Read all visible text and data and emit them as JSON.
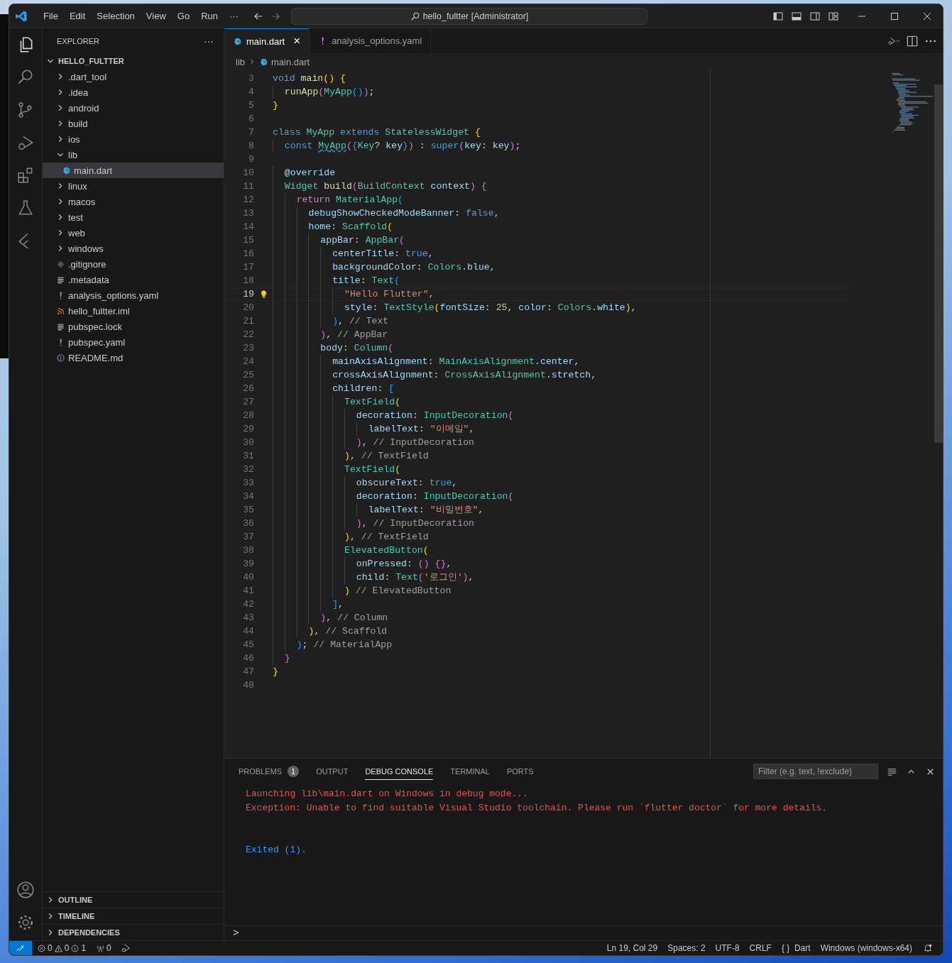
{
  "window": {
    "title": "hello_fultter [Administrator]",
    "menu": [
      "File",
      "Edit",
      "Selection",
      "View",
      "Go",
      "Run"
    ],
    "more": "···"
  },
  "sidebar": {
    "title": "EXPLORER",
    "more": "···",
    "root": {
      "label": "HELLO_FULTTER",
      "expanded": true
    },
    "tree": [
      {
        "label": ".dart_tool",
        "kind": "folder",
        "expanded": false,
        "selected": false
      },
      {
        "label": ".idea",
        "kind": "folder",
        "expanded": false,
        "selected": false
      },
      {
        "label": "android",
        "kind": "folder",
        "expanded": false,
        "selected": false
      },
      {
        "label": "build",
        "kind": "folder",
        "expanded": false,
        "selected": false
      },
      {
        "label": "ios",
        "kind": "folder",
        "expanded": false,
        "selected": false
      },
      {
        "label": "lib",
        "kind": "folder",
        "expanded": true,
        "selected": false,
        "children": [
          {
            "label": "main.dart",
            "kind": "dart",
            "selected": true
          }
        ]
      },
      {
        "label": "linux",
        "kind": "folder",
        "expanded": false,
        "selected": false
      },
      {
        "label": "macos",
        "kind": "folder",
        "expanded": false,
        "selected": false
      },
      {
        "label": "test",
        "kind": "folder",
        "expanded": false,
        "selected": false
      },
      {
        "label": "web",
        "kind": "folder",
        "expanded": false,
        "selected": false
      },
      {
        "label": "windows",
        "kind": "folder",
        "expanded": false,
        "selected": false
      },
      {
        "label": ".gitignore",
        "kind": "git",
        "selected": false
      },
      {
        "label": ".metadata",
        "kind": "lines",
        "selected": false
      },
      {
        "label": "analysis_options.yaml",
        "kind": "yaml",
        "selected": false
      },
      {
        "label": "hello_fultter.iml",
        "kind": "feed",
        "selected": false
      },
      {
        "label": "pubspec.lock",
        "kind": "lines",
        "selected": false
      },
      {
        "label": "pubspec.yaml",
        "kind": "yaml",
        "selected": false
      },
      {
        "label": "README.md",
        "kind": "info",
        "selected": false
      }
    ],
    "sections": [
      {
        "label": "OUTLINE",
        "expanded": false
      },
      {
        "label": "TIMELINE",
        "expanded": false
      },
      {
        "label": "DEPENDENCIES",
        "expanded": false
      }
    ]
  },
  "editor": {
    "tabs": [
      {
        "label": "main.dart",
        "kind": "dart",
        "selected": true,
        "close": "×"
      },
      {
        "label": "analysis_options.yaml",
        "kind": "yaml",
        "selected": false
      }
    ],
    "breadcrumb": [
      "lib",
      "main.dart"
    ],
    "lines": [
      {
        "n": "3",
        "current": false,
        "tokens": [
          {
            "kind": "kw",
            "text": "void"
          },
          {
            "kind": "fn",
            "text": " main"
          },
          {
            "kind": "b1",
            "text": "()"
          },
          {
            "kind": "b1",
            "text": " {"
          }
        ]
      },
      {
        "n": "4",
        "current": false,
        "tokens": [
          {
            "kind": "fn",
            "text": "  runApp"
          },
          {
            "kind": "b2",
            "text": "("
          },
          {
            "kind": "type",
            "text": "MyApp"
          },
          {
            "kind": "b3",
            "text": "()"
          },
          {
            "kind": "b2",
            "text": ")"
          },
          {
            "kind": "p",
            "text": ";"
          }
        ]
      },
      {
        "n": "5",
        "current": false,
        "tokens": [
          {
            "kind": "b1",
            "text": "}"
          }
        ]
      },
      {
        "n": "6",
        "current": false
      },
      {
        "n": "7",
        "current": false,
        "tokens": [
          {
            "kind": "kw",
            "text": "class"
          },
          {
            "kind": "type",
            "text": " MyApp"
          },
          {
            "kind": "kw",
            "text": " extends"
          },
          {
            "kind": "type",
            "text": " StatelessWidget"
          },
          {
            "kind": "b1",
            "text": " {"
          }
        ]
      },
      {
        "n": "8",
        "current": false,
        "tokens": [
          {
            "kind": "kw",
            "text": "  const "
          },
          {
            "kind": "warn",
            "text": "MyApp"
          },
          {
            "kind": "b2",
            "text": "("
          },
          {
            "kind": "b3",
            "text": "{"
          },
          {
            "kind": "type",
            "text": "Key"
          },
          {
            "kind": "p",
            "text": "? "
          },
          {
            "kind": "var",
            "text": "key"
          },
          {
            "kind": "b3",
            "text": "}"
          },
          {
            "kind": "b2",
            "text": ")"
          },
          {
            "kind": "p",
            "text": " : "
          },
          {
            "kind": "kw",
            "text": "super"
          },
          {
            "kind": "b2",
            "text": "("
          },
          {
            "kind": "var",
            "text": "key"
          },
          {
            "kind": "p",
            "text": ": "
          },
          {
            "kind": "var",
            "text": "key"
          },
          {
            "kind": "b2",
            "text": ")"
          },
          {
            "kind": "p",
            "text": ";"
          }
        ]
      },
      {
        "n": "9",
        "current": false
      },
      {
        "n": "10",
        "current": false,
        "tokens": [
          {
            "kind": "var",
            "text": "  @override"
          }
        ]
      },
      {
        "n": "11",
        "current": false,
        "tokens": [
          {
            "kind": "type",
            "text": "  Widget"
          },
          {
            "kind": "fn",
            "text": " build"
          },
          {
            "kind": "b2",
            "text": "("
          },
          {
            "kind": "type",
            "text": "BuildContext"
          },
          {
            "kind": "var",
            "text": " context"
          },
          {
            "kind": "b2",
            "text": ")"
          },
          {
            "kind": "b2",
            "text": " {"
          }
        ]
      },
      {
        "n": "12",
        "current": false,
        "tokens": [
          {
            "kind": "ctrl",
            "text": "    return"
          },
          {
            "kind": "type",
            "text": " MaterialApp"
          },
          {
            "kind": "b3",
            "text": "("
          }
        ]
      },
      {
        "n": "13",
        "current": false,
        "tokens": [
          {
            "kind": "var",
            "text": "      debugShowCheckedModeBanner"
          },
          {
            "kind": "p",
            "text": ": "
          },
          {
            "kind": "kw",
            "text": "false"
          },
          {
            "kind": "p",
            "text": ","
          }
        ]
      },
      {
        "n": "14",
        "current": false,
        "tokens": [
          {
            "kind": "var",
            "text": "      home"
          },
          {
            "kind": "p",
            "text": ": "
          },
          {
            "kind": "type",
            "text": "Scaffold"
          },
          {
            "kind": "b1",
            "text": "("
          }
        ]
      },
      {
        "n": "15",
        "current": false,
        "tokens": [
          {
            "kind": "var",
            "text": "        appBar"
          },
          {
            "kind": "p",
            "text": ": "
          },
          {
            "kind": "type",
            "text": "AppBar"
          },
          {
            "kind": "b2",
            "text": "("
          }
        ]
      },
      {
        "n": "16",
        "current": false,
        "tokens": [
          {
            "kind": "var",
            "text": "          centerTitle"
          },
          {
            "kind": "p",
            "text": ": "
          },
          {
            "kind": "kw",
            "text": "true"
          },
          {
            "kind": "p",
            "text": ","
          }
        ]
      },
      {
        "n": "17",
        "current": false,
        "tokens": [
          {
            "kind": "var",
            "text": "          backgroundColor"
          },
          {
            "kind": "p",
            "text": ": "
          },
          {
            "kind": "type",
            "text": "Colors"
          },
          {
            "kind": "p",
            "text": "."
          },
          {
            "kind": "var",
            "text": "blue"
          },
          {
            "kind": "p",
            "text": ","
          }
        ]
      },
      {
        "n": "18",
        "current": false,
        "tokens": [
          {
            "kind": "var",
            "text": "          title"
          },
          {
            "kind": "p",
            "text": ": "
          },
          {
            "kind": "type",
            "text": "Text"
          },
          {
            "kind": "b3",
            "text": "("
          }
        ]
      },
      {
        "n": "19",
        "current": true,
        "tokens": [
          {
            "kind": "str",
            "text": "            \"Hello Flutter\""
          },
          {
            "kind": "p",
            "text": ","
          }
        ]
      },
      {
        "n": "20",
        "current": false,
        "tokens": [
          {
            "kind": "var",
            "text": "            style"
          },
          {
            "kind": "p",
            "text": ": "
          },
          {
            "kind": "type",
            "text": "TextStyle"
          },
          {
            "kind": "b1",
            "text": "("
          },
          {
            "kind": "var",
            "text": "fontSize"
          },
          {
            "kind": "p",
            "text": ": "
          },
          {
            "kind": "num",
            "text": "25"
          },
          {
            "kind": "p",
            "text": ", "
          },
          {
            "kind": "var",
            "text": "color"
          },
          {
            "kind": "p",
            "text": ": "
          },
          {
            "kind": "type",
            "text": "Colors"
          },
          {
            "kind": "p",
            "text": "."
          },
          {
            "kind": "var",
            "text": "white"
          },
          {
            "kind": "b1",
            "text": ")"
          },
          {
            "kind": "p",
            "text": ","
          }
        ]
      },
      {
        "n": "21",
        "current": false,
        "tokens": [
          {
            "kind": "b3",
            "text": "          )"
          },
          {
            "kind": "p",
            "text": ", "
          },
          {
            "kind": "cmt",
            "text": "// Text"
          }
        ]
      },
      {
        "n": "22",
        "current": false,
        "tokens": [
          {
            "kind": "b2",
            "text": "        )"
          },
          {
            "kind": "p",
            "text": ", "
          },
          {
            "kind": "cmt",
            "text": "// AppBar"
          }
        ]
      },
      {
        "n": "23",
        "current": false,
        "tokens": [
          {
            "kind": "var",
            "text": "        body"
          },
          {
            "kind": "p",
            "text": ": "
          },
          {
            "kind": "type",
            "text": "Column"
          },
          {
            "kind": "b2",
            "text": "("
          }
        ]
      },
      {
        "n": "24",
        "current": false,
        "tokens": [
          {
            "kind": "var",
            "text": "          mainAxisAlignment"
          },
          {
            "kind": "p",
            "text": ": "
          },
          {
            "kind": "type",
            "text": "MainAxisAlignment"
          },
          {
            "kind": "p",
            "text": "."
          },
          {
            "kind": "var",
            "text": "center"
          },
          {
            "kind": "p",
            "text": ","
          }
        ]
      },
      {
        "n": "25",
        "current": false,
        "tokens": [
          {
            "kind": "var",
            "text": "          crossAxisAlignment"
          },
          {
            "kind": "p",
            "text": ": "
          },
          {
            "kind": "type",
            "text": "CrossAxisAlignment"
          },
          {
            "kind": "p",
            "text": "."
          },
          {
            "kind": "var",
            "text": "stretch"
          },
          {
            "kind": "p",
            "text": ","
          }
        ]
      },
      {
        "n": "26",
        "current": false,
        "tokens": [
          {
            "kind": "var",
            "text": "          children"
          },
          {
            "kind": "p",
            "text": ": "
          },
          {
            "kind": "b3",
            "text": "["
          }
        ]
      },
      {
        "n": "27",
        "current": false,
        "tokens": [
          {
            "kind": "type",
            "text": "            TextField"
          },
          {
            "kind": "b1",
            "text": "("
          }
        ]
      },
      {
        "n": "28",
        "current": false,
        "tokens": [
          {
            "kind": "var",
            "text": "              decoration"
          },
          {
            "kind": "p",
            "text": ": "
          },
          {
            "kind": "type",
            "text": "InputDecoration"
          },
          {
            "kind": "b2",
            "text": "("
          }
        ]
      },
      {
        "n": "29",
        "current": false,
        "tokens": [
          {
            "kind": "var",
            "text": "                labelText"
          },
          {
            "kind": "p",
            "text": ": "
          },
          {
            "kind": "str",
            "text": "\"이메일\""
          },
          {
            "kind": "p",
            "text": ","
          }
        ]
      },
      {
        "n": "30",
        "current": false,
        "tokens": [
          {
            "kind": "b2",
            "text": "              )"
          },
          {
            "kind": "p",
            "text": ", "
          },
          {
            "kind": "cmt",
            "text": "// InputDecoration"
          }
        ]
      },
      {
        "n": "31",
        "current": false,
        "tokens": [
          {
            "kind": "b1",
            "text": "            )"
          },
          {
            "kind": "p",
            "text": ", "
          },
          {
            "kind": "cmt",
            "text": "// TextField"
          }
        ]
      },
      {
        "n": "32",
        "current": false,
        "tokens": [
          {
            "kind": "type",
            "text": "            TextField"
          },
          {
            "kind": "b1",
            "text": "("
          }
        ]
      },
      {
        "n": "33",
        "current": false,
        "tokens": [
          {
            "kind": "var",
            "text": "              obscureText"
          },
          {
            "kind": "p",
            "text": ": "
          },
          {
            "kind": "kw",
            "text": "true"
          },
          {
            "kind": "p",
            "text": ","
          }
        ]
      },
      {
        "n": "34",
        "current": false,
        "tokens": [
          {
            "kind": "var",
            "text": "              decoration"
          },
          {
            "kind": "p",
            "text": ": "
          },
          {
            "kind": "type",
            "text": "InputDecoration"
          },
          {
            "kind": "b2",
            "text": "("
          }
        ]
      },
      {
        "n": "35",
        "current": false,
        "tokens": [
          {
            "kind": "var",
            "text": "                labelText"
          },
          {
            "kind": "p",
            "text": ": "
          },
          {
            "kind": "str",
            "text": "\"비밀번호\""
          },
          {
            "kind": "p",
            "text": ","
          }
        ]
      },
      {
        "n": "36",
        "current": false,
        "tokens": [
          {
            "kind": "b2",
            "text": "              )"
          },
          {
            "kind": "p",
            "text": ", "
          },
          {
            "kind": "cmt",
            "text": "// InputDecoration"
          }
        ]
      },
      {
        "n": "37",
        "current": false,
        "tokens": [
          {
            "kind": "b1",
            "text": "            )"
          },
          {
            "kind": "p",
            "text": ", "
          },
          {
            "kind": "cmt",
            "text": "// TextField"
          }
        ]
      },
      {
        "n": "38",
        "current": false,
        "tokens": [
          {
            "kind": "type",
            "text": "            ElevatedButton"
          },
          {
            "kind": "b1",
            "text": "("
          }
        ]
      },
      {
        "n": "39",
        "current": false,
        "tokens": [
          {
            "kind": "var",
            "text": "              onPressed"
          },
          {
            "kind": "p",
            "text": ": "
          },
          {
            "kind": "b2",
            "text": "()"
          },
          {
            "kind": "b2",
            "text": " {}"
          },
          {
            "kind": "p",
            "text": ","
          }
        ]
      },
      {
        "n": "40",
        "current": false,
        "tokens": [
          {
            "kind": "var",
            "text": "              child"
          },
          {
            "kind": "p",
            "text": ": "
          },
          {
            "kind": "type",
            "text": "Text"
          },
          {
            "kind": "b2",
            "text": "("
          },
          {
            "kind": "str",
            "text": "'로그인'"
          },
          {
            "kind": "b2",
            "text": ")"
          },
          {
            "kind": "p",
            "text": ","
          }
        ]
      },
      {
        "n": "41",
        "current": false,
        "tokens": [
          {
            "kind": "b1",
            "text": "            )"
          },
          {
            "kind": "cmt",
            "text": " // ElevatedButton"
          }
        ]
      },
      {
        "n": "42",
        "current": false,
        "tokens": [
          {
            "kind": "b3",
            "text": "          ]"
          },
          {
            "kind": "p",
            "text": ","
          }
        ]
      },
      {
        "n": "43",
        "current": false,
        "tokens": [
          {
            "kind": "b2",
            "text": "        )"
          },
          {
            "kind": "p",
            "text": ", "
          },
          {
            "kind": "cmt",
            "text": "// Column"
          }
        ]
      },
      {
        "n": "44",
        "current": false,
        "tokens": [
          {
            "kind": "b1",
            "text": "      )"
          },
          {
            "kind": "p",
            "text": ", "
          },
          {
            "kind": "cmt",
            "text": "// Scaffold"
          }
        ]
      },
      {
        "n": "45",
        "current": false,
        "tokens": [
          {
            "kind": "b3",
            "text": "    )"
          },
          {
            "kind": "p",
            "text": "; "
          },
          {
            "kind": "cmt",
            "text": "// MaterialApp"
          }
        ]
      },
      {
        "n": "46",
        "current": false,
        "tokens": [
          {
            "kind": "b2",
            "text": "  }"
          }
        ]
      },
      {
        "n": "47",
        "current": false,
        "tokens": [
          {
            "kind": "b1",
            "text": "}"
          }
        ]
      },
      {
        "n": "48",
        "current": false
      }
    ]
  },
  "panel": {
    "tabs": [
      {
        "label": "PROBLEMS",
        "badge": "1",
        "selected": false
      },
      {
        "label": "OUTPUT",
        "selected": false
      },
      {
        "label": "DEBUG CONSOLE",
        "selected": true
      },
      {
        "label": "TERMINAL",
        "selected": false
      },
      {
        "label": "PORTS",
        "selected": false
      }
    ],
    "filter": {
      "placeholder": "Filter (e.g. text, !exclude)"
    },
    "output": [
      {
        "kind": "error",
        "text": "Launching lib\\main.dart on Windows in debug mode..."
      },
      {
        "kind": "error",
        "text": "Exception: Unable to find suitable Visual Studio toolchain. Please run `flutter doctor` for more details."
      },
      {
        "kind": "blank"
      },
      {
        "kind": "info",
        "text": "Exited (1)."
      }
    ],
    "prompt": ">"
  },
  "status_bar": {
    "errors": "0",
    "warnings": "0",
    "infos": "1",
    "ports": "0",
    "position": "Ln 19, Col 29",
    "indent": "Spaces: 2",
    "encoding": "UTF-8",
    "eol": "CRLF",
    "language_icon": "{ }",
    "language": "Dart",
    "platform": "Windows (windows-x64)"
  }
}
